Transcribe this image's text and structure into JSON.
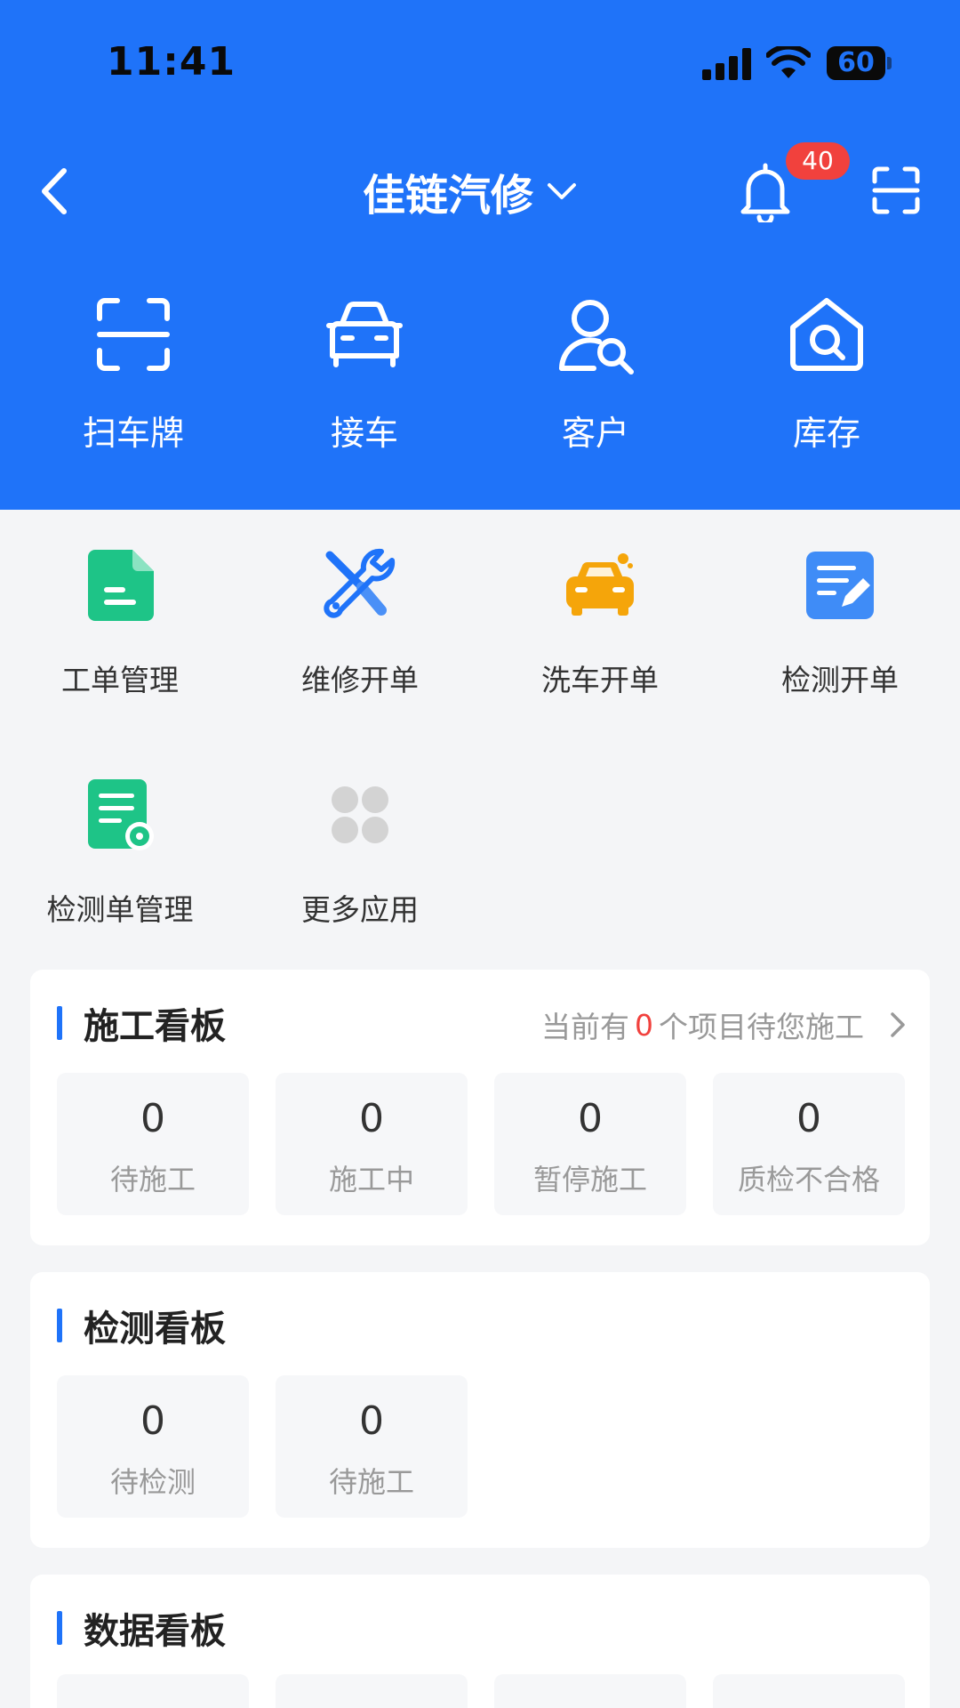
{
  "status": {
    "time": "11:41",
    "battery": "60"
  },
  "nav": {
    "title": "佳链汽修",
    "badge": "40"
  },
  "quick": [
    {
      "label": "扫车牌",
      "icon": "scan-plate-icon"
    },
    {
      "label": "接车",
      "icon": "car-icon"
    },
    {
      "label": "客户",
      "icon": "user-search-icon"
    },
    {
      "label": "库存",
      "icon": "house-search-icon"
    }
  ],
  "apps": [
    {
      "label": "工单管理",
      "icon": "document-icon",
      "color": "#1ec487"
    },
    {
      "label": "维修开单",
      "icon": "tools-icon",
      "color": "#1f73f9"
    },
    {
      "label": "洗车开单",
      "icon": "car-wash-icon",
      "color": "#f5a50a"
    },
    {
      "label": "检测开单",
      "icon": "edit-note-icon",
      "color": "#3f8cf7"
    },
    {
      "label": "检测单管理",
      "icon": "note-gear-icon",
      "color": "#1ec487"
    },
    {
      "label": "更多应用",
      "icon": "more-apps-icon",
      "color": "#d3d3d3"
    }
  ],
  "construction": {
    "title": "施工看板",
    "note_prefix": "当前有",
    "note_count": "0",
    "note_suffix": "个项目待您施工",
    "stats": [
      {
        "value": "0",
        "label": "待施工"
      },
      {
        "value": "0",
        "label": "施工中"
      },
      {
        "value": "0",
        "label": "暂停施工"
      },
      {
        "value": "0",
        "label": "质检不合格"
      }
    ]
  },
  "inspection": {
    "title": "检测看板",
    "stats": [
      {
        "value": "0",
        "label": "待检测"
      },
      {
        "value": "0",
        "label": "待施工"
      }
    ]
  },
  "data_board": {
    "title": "数据看板"
  }
}
